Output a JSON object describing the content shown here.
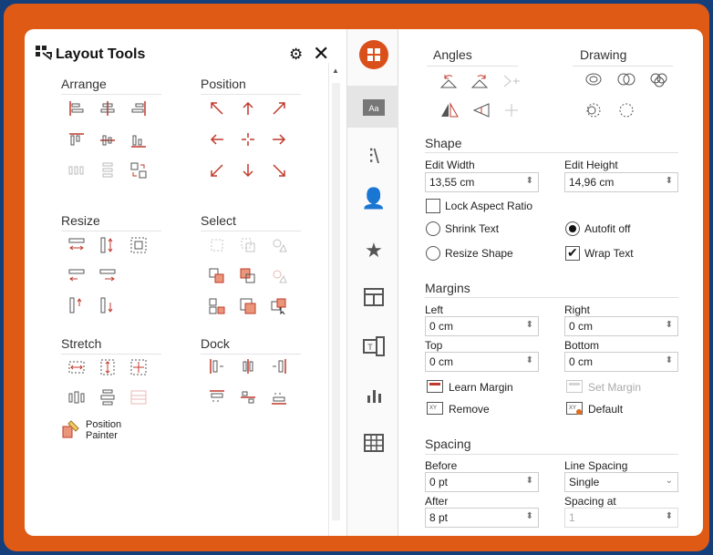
{
  "layout_tools": {
    "title": "Layout Tools",
    "sections": {
      "arrange": "Arrange",
      "position": "Position",
      "resize": "Resize",
      "select": "Select",
      "stretch": "Stretch",
      "dock": "Dock"
    },
    "position_painter": [
      "Position",
      "Painter"
    ]
  },
  "rail": {
    "items": [
      "office-logo-icon",
      "slide-layout-icon",
      "library-icon",
      "contacts-icon",
      "star-icon",
      "table-layout-icon",
      "text-box-icon",
      "bar-chart-icon",
      "grid-table-icon"
    ]
  },
  "properties": {
    "angles": "Angles",
    "drawing": "Drawing",
    "shape": {
      "heading": "Shape",
      "edit_width_label": "Edit Width",
      "edit_width_value": "13,55 cm",
      "edit_height_label": "Edit Height",
      "edit_height_value": "14,96 cm",
      "lock_aspect_ratio": "Lock Aspect Ratio",
      "shrink_text": "Shrink Text",
      "autofit_off": "Autofit off",
      "resize_shape": "Resize Shape",
      "wrap_text": "Wrap Text"
    },
    "margins": {
      "heading": "Margins",
      "left_label": "Left",
      "left_value": "0 cm",
      "right_label": "Right",
      "right_value": "0 cm",
      "top_label": "Top",
      "top_value": "0 cm",
      "bottom_label": "Bottom",
      "bottom_value": "0 cm",
      "learn_margin": "Learn Margin",
      "set_margin": "Set Margin",
      "remove": "Remove",
      "default": "Default"
    },
    "spacing": {
      "heading": "Spacing",
      "before_label": "Before",
      "before_value": "0 pt",
      "line_spacing_label": "Line Spacing",
      "line_spacing_value": "Single",
      "after_label": "After",
      "after_value": "8 pt",
      "spacing_at_label": "Spacing at",
      "spacing_at_value": "1"
    }
  },
  "colors": {
    "frame": "#df5a14",
    "background": "#153f7a",
    "accent": "#d9501b"
  }
}
